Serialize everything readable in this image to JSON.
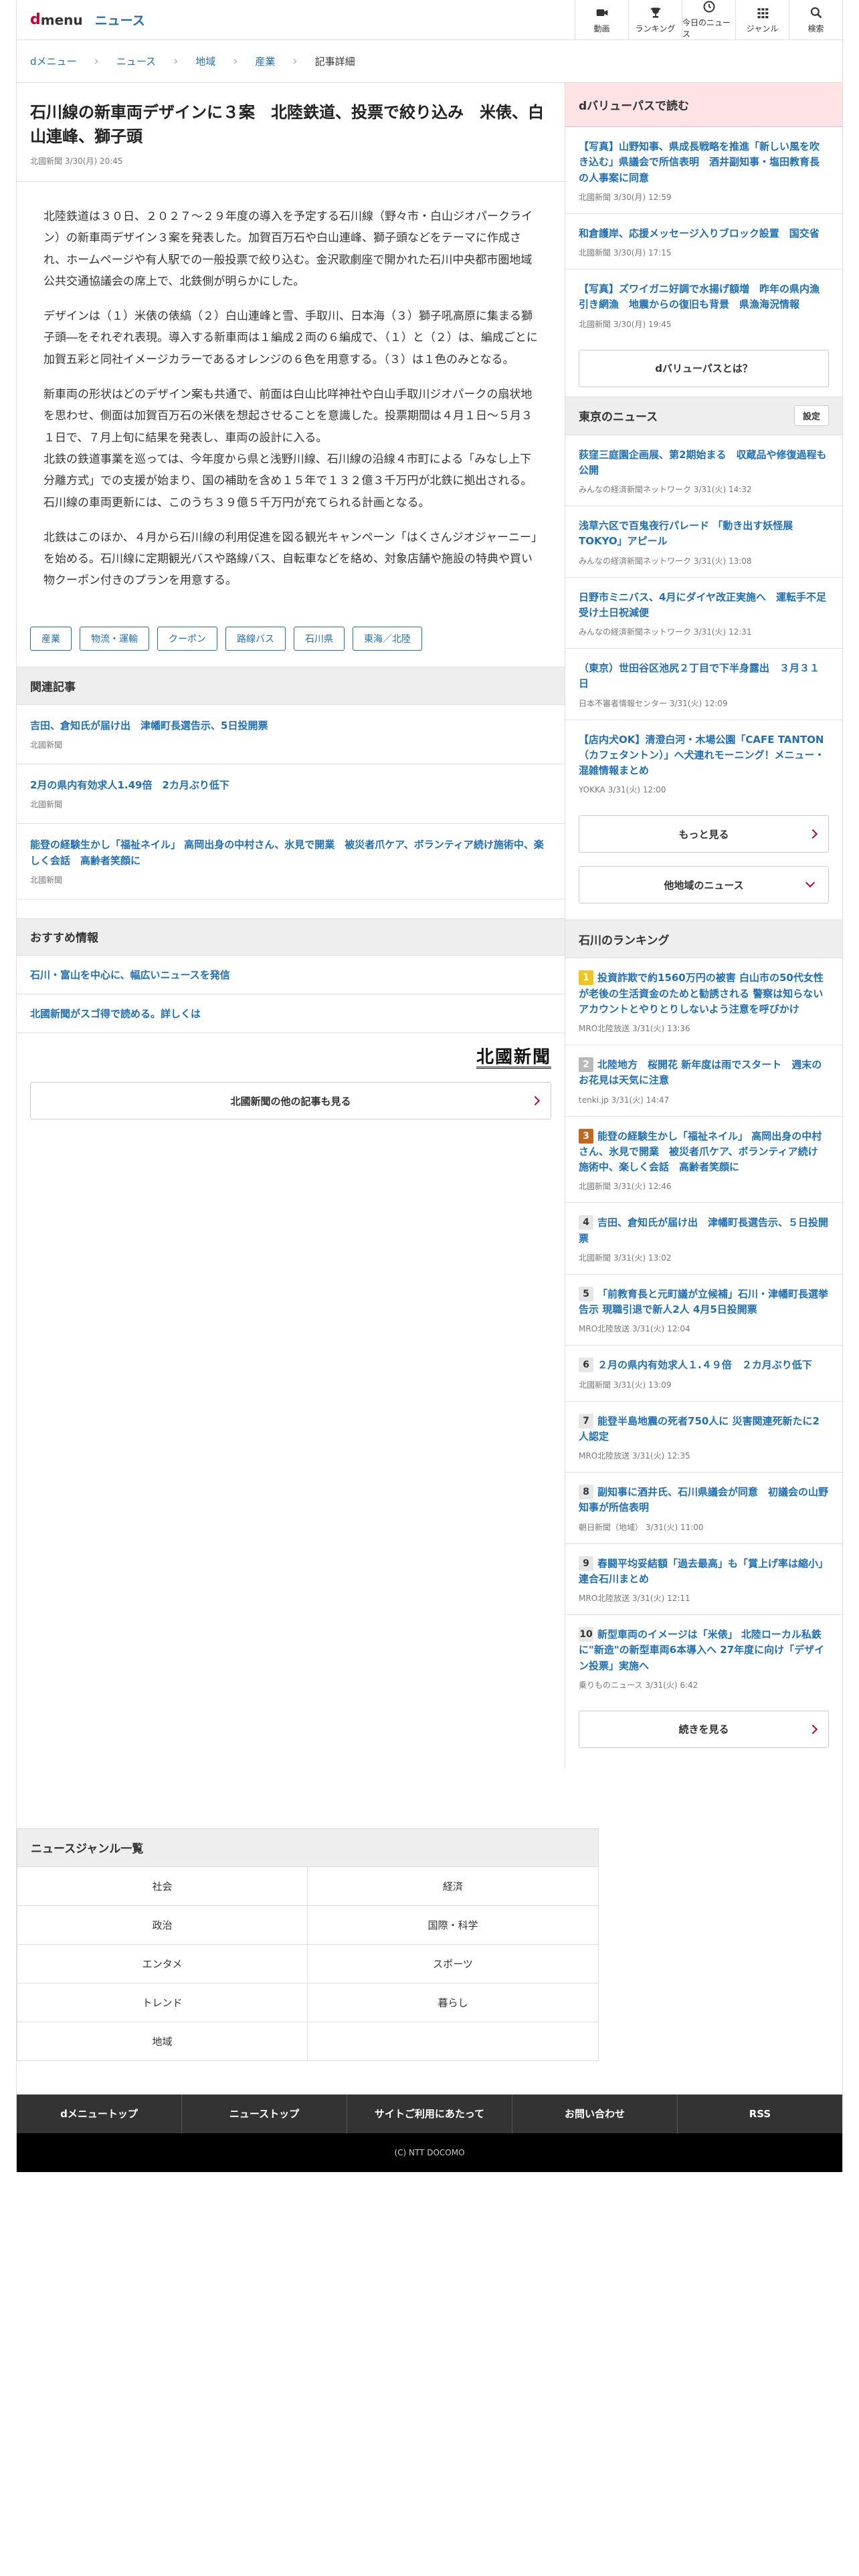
{
  "header": {
    "logo_d": "d",
    "logo_menu": "menu",
    "logo_news": "ニュース",
    "nav": [
      {
        "label": "動画",
        "icon": "video-icon"
      },
      {
        "label": "ランキング",
        "icon": "trophy-icon"
      },
      {
        "label": "今日のニュース",
        "icon": "clock-icon"
      },
      {
        "label": "ジャンル",
        "icon": "grid-icon"
      },
      {
        "label": "検索",
        "icon": "search-icon"
      }
    ]
  },
  "breadcrumb": [
    "dメニュー",
    "ニュース",
    "地域",
    "産業",
    "記事詳細"
  ],
  "article": {
    "title": "石川線の新車両デザインに３案　北陸鉄道、投票で絞り込み　米俵、白山連峰、獅子頭",
    "source": "北國新聞",
    "date": "3/30(月) 20:45",
    "paragraphs": [
      "北陸鉄道は３０日、２０２７～２９年度の導入を予定する石川線（野々市・白山ジオパークライン）の新車両デザイン３案を発表した。加賀百万石や白山連峰、獅子頭などをテーマに作成され、ホームページや有人駅での一般投票で絞り込む。金沢歌劇座で開かれた石川中央都市圏地域公共交通協議会の席上で、北鉄側が明らかにした。",
      "デザインは（１）米俵の俵縞（２）白山連峰と雪、手取川、日本海（３）獅子吼高原に集まる獅子頭―をそれぞれ表現。導入する新車両は１編成２両の６編成で、（１）と（２）は、編成ごとに加賀五彩と同社イメージカラーであるオレンジの６色を用意する。（３）は１色のみとなる。",
      "新車両の形状はどのデザイン案も共通で、前面は白山比咩神社や白山手取川ジオパークの扇状地を思わせ、側面は加賀百万石の米俵を想起させることを意識した。投票期間は４月１日～５月３１日で、７月上旬に結果を発表し、車両の設計に入る。",
      "北鉄の鉄道事業を巡っては、今年度から県と浅野川線、石川線の沿線４市町による「みなし上下分離方式」での支援が始まり、国の補助を含め１５年で１３２億３千万円が北鉄に拠出される。石川線の車両更新には、このうち３９億５千万円が充てられる計画となる。",
      "北鉄はこのほか、４月から石川線の利用促進を図る観光キャンペーン「はくさんジオジャーニー」を始める。石川線に定期観光バスや路線バス、自転車などを絡め、対象店舗や施設の特典や買い物クーポン付きのプランを用意する。"
    ],
    "tags": [
      "産業",
      "物流・運輸",
      "クーポン",
      "路線バス",
      "石川県",
      "東海／北陸"
    ]
  },
  "related": {
    "heading": "関連記事",
    "items": [
      {
        "title": "吉田、倉知氏が届け出　津幡町長選告示、5日投開票",
        "source": "北國新聞"
      },
      {
        "title": "2月の県内有効求人1.49倍　2カ月ぶり低下",
        "source": "北國新聞"
      },
      {
        "title": "能登の経験生かし「福祉ネイル」 高岡出身の中村さん、氷見で開業　被災者爪ケア、ボランティア続け施術中、楽しく会話　高齢者笑顔に",
        "source": "北國新聞"
      }
    ]
  },
  "recommend": {
    "heading": "おすすめ情報",
    "items": [
      "石川・富山を中心に、幅広いニュースを発信",
      "北國新聞がスゴ得で読める。詳しくは"
    ]
  },
  "publisher_logo": "北國新聞",
  "more_articles_button": "北國新聞の他の記事も見る",
  "sidebar": {
    "dvalue_heading": "dバリューパスで読む",
    "dvalue_items": [
      {
        "title": "【写真】山野知事、県成長戦略を推進「新しい風を吹き込む」県議会で所信表明　酒井副知事・塩田教育長の人事案に同意",
        "source": "北國新聞",
        "date": "3/30(月) 12:59"
      },
      {
        "title": "和倉護岸、応援メッセージ入りブロック設置　国交省",
        "source": "北國新聞",
        "date": "3/30(月) 17:15"
      },
      {
        "title": "【写真】ズワイガニ好調で水揚げ額増　昨年の県内漁引き網漁　地震からの復旧も背景　県漁海況情報",
        "source": "北國新聞",
        "date": "3/30(月) 19:45"
      }
    ],
    "dvalue_button": "dバリューパスとは？",
    "tokyo_heading": "東京のニュース",
    "settings_label": "設定",
    "tokyo_items": [
      {
        "title": "荻窪三庭園企画展、第2期始まる　収蔵品や修復過程も公開",
        "source": "みんなの経済新聞ネットワーク",
        "date": "3/31(火) 14:32"
      },
      {
        "title": "浅草六区で百鬼夜行パレード 「動き出す妖怪展TOKYO」アピール",
        "source": "みんなの経済新聞ネットワーク",
        "date": "3/31(火) 13:08"
      },
      {
        "title": "日野市ミニバス、4月にダイヤ改正実施へ　運転手不足受け土日祝減便",
        "source": "みんなの経済新聞ネットワーク",
        "date": "3/31(火) 12:31"
      },
      {
        "title": "（東京）世田谷区池尻２丁目で下半身露出　３月３１日",
        "source": "日本不審者情報センター",
        "date": "3/31(火) 12:09"
      },
      {
        "title": "【店内犬OK】清澄白河・木場公園「CAFE TANTON（カフェタントン）」へ犬連れモーニング！メニュー・混雑情報まとめ",
        "source": "YOKKA",
        "date": "3/31(火) 12:00"
      }
    ],
    "more_button": "もっと見る",
    "other_region_button": "他地域のニュース",
    "ranking_heading": "石川のランキング",
    "ranking": [
      {
        "rank": "1",
        "title": "投資詐欺で約1560万円の被害 白山市の50代女性が老後の生活資金のためと勧誘される 警察は知らないアカウントとやりとりしないよう注意を呼びかけ",
        "source": "MRO北陸放送",
        "date": "3/31(火) 13:36"
      },
      {
        "rank": "2",
        "title": "北陸地方　桜開花 新年度は雨でスタート　週末のお花見は天気に注意",
        "source": "tenki.jp",
        "date": "3/31(火) 14:47"
      },
      {
        "rank": "3",
        "title": "能登の経験生かし「福祉ネイル」 高岡出身の中村さん、氷見で開業　被災者爪ケア、ボランティア続け　施術中、楽しく会話　高齢者笑顔に",
        "source": "北國新聞",
        "date": "3/31(火) 12:46"
      },
      {
        "rank": "4",
        "title": "吉田、倉知氏が届け出　津幡町長選告示、５日投開票",
        "source": "北國新聞",
        "date": "3/31(火) 13:02"
      },
      {
        "rank": "5",
        "title": "「前教育長と元町議が立候補」石川・津幡町長選挙告示 現職引退で新人2人 4月5日投開票",
        "source": "MRO北陸放送",
        "date": "3/31(火) 12:04"
      },
      {
        "rank": "6",
        "title": "２月の県内有効求人１.４９倍　２カ月ぶり低下",
        "source": "北國新聞",
        "date": "3/31(火) 13:09"
      },
      {
        "rank": "7",
        "title": "能登半島地震の死者750人に 災害関連死新たに2人認定",
        "source": "MRO北陸放送",
        "date": "3/31(火) 12:35"
      },
      {
        "rank": "8",
        "title": "副知事に酒井氏、石川県議会が同意　初議会の山野知事が所信表明",
        "source": "朝日新聞（地域）",
        "date": "3/31(火) 11:00"
      },
      {
        "rank": "9",
        "title": "春闘平均妥結額「過去最高」も「賞上げ率は縮小」連合石川まとめ",
        "source": "MRO北陸放送",
        "date": "3/31(火) 12:11"
      },
      {
        "rank": "10",
        "title": "新型車両のイメージは「米俵」 北陸ローカル私鉄に\"新造\"の新型車両6本導入へ 27年度に向け「デザイン投票」実施へ",
        "source": "乗りものニュース",
        "date": "3/31(火) 6:42"
      }
    ],
    "ranking_more_button": "続きを見る"
  },
  "genre": {
    "heading": "ニュースジャンル一覧",
    "items": [
      "社会",
      "経済",
      "政治",
      "国際・科学",
      "エンタメ",
      "スポーツ",
      "トレンド",
      "暮らし",
      "地域",
      ""
    ]
  },
  "footer": {
    "links": [
      "dメニュートップ",
      "ニューストップ",
      "サイトご利用にあたって",
      "お問い合わせ",
      "RSS"
    ],
    "copyright": "(C) NTT DOCOMO"
  }
}
